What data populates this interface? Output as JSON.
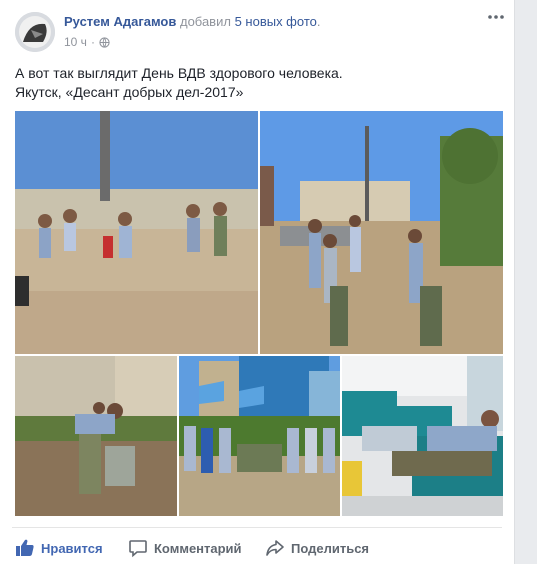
{
  "post": {
    "author_name": "Рустем Адагамов",
    "action_prefix": "добавил",
    "action_link": "5 новых фото",
    "action_suffix": ".",
    "timestamp": "10 ч",
    "separator": "·",
    "privacy_icon": "globe-icon",
    "menu_icon": "more-options-icon",
    "text_line_1": "А вот так выглядит День ВДВ здорового человека.",
    "text_line_2": "Якутск, «Десант добрых дел-2017»"
  },
  "photos": [
    {
      "name": "photo-1",
      "subject": "volunteers-cleaning-field"
    },
    {
      "name": "photo-2",
      "subject": "volunteers-with-bags"
    },
    {
      "name": "photo-3",
      "subject": "man-collecting-trash"
    },
    {
      "name": "photo-4",
      "subject": "group-with-flags"
    },
    {
      "name": "photo-5",
      "subject": "blood-donation"
    }
  ],
  "actions": {
    "like": {
      "label": "Нравится",
      "icon": "thumbs-up-icon",
      "color": "#4267b2"
    },
    "comment": {
      "label": "Комментарий",
      "icon": "comment-icon"
    },
    "share": {
      "label": "Поделиться",
      "icon": "share-icon"
    }
  },
  "colors": {
    "link": "#365899",
    "meta": "#90949c",
    "text": "#1d2129",
    "action": "#606770"
  }
}
